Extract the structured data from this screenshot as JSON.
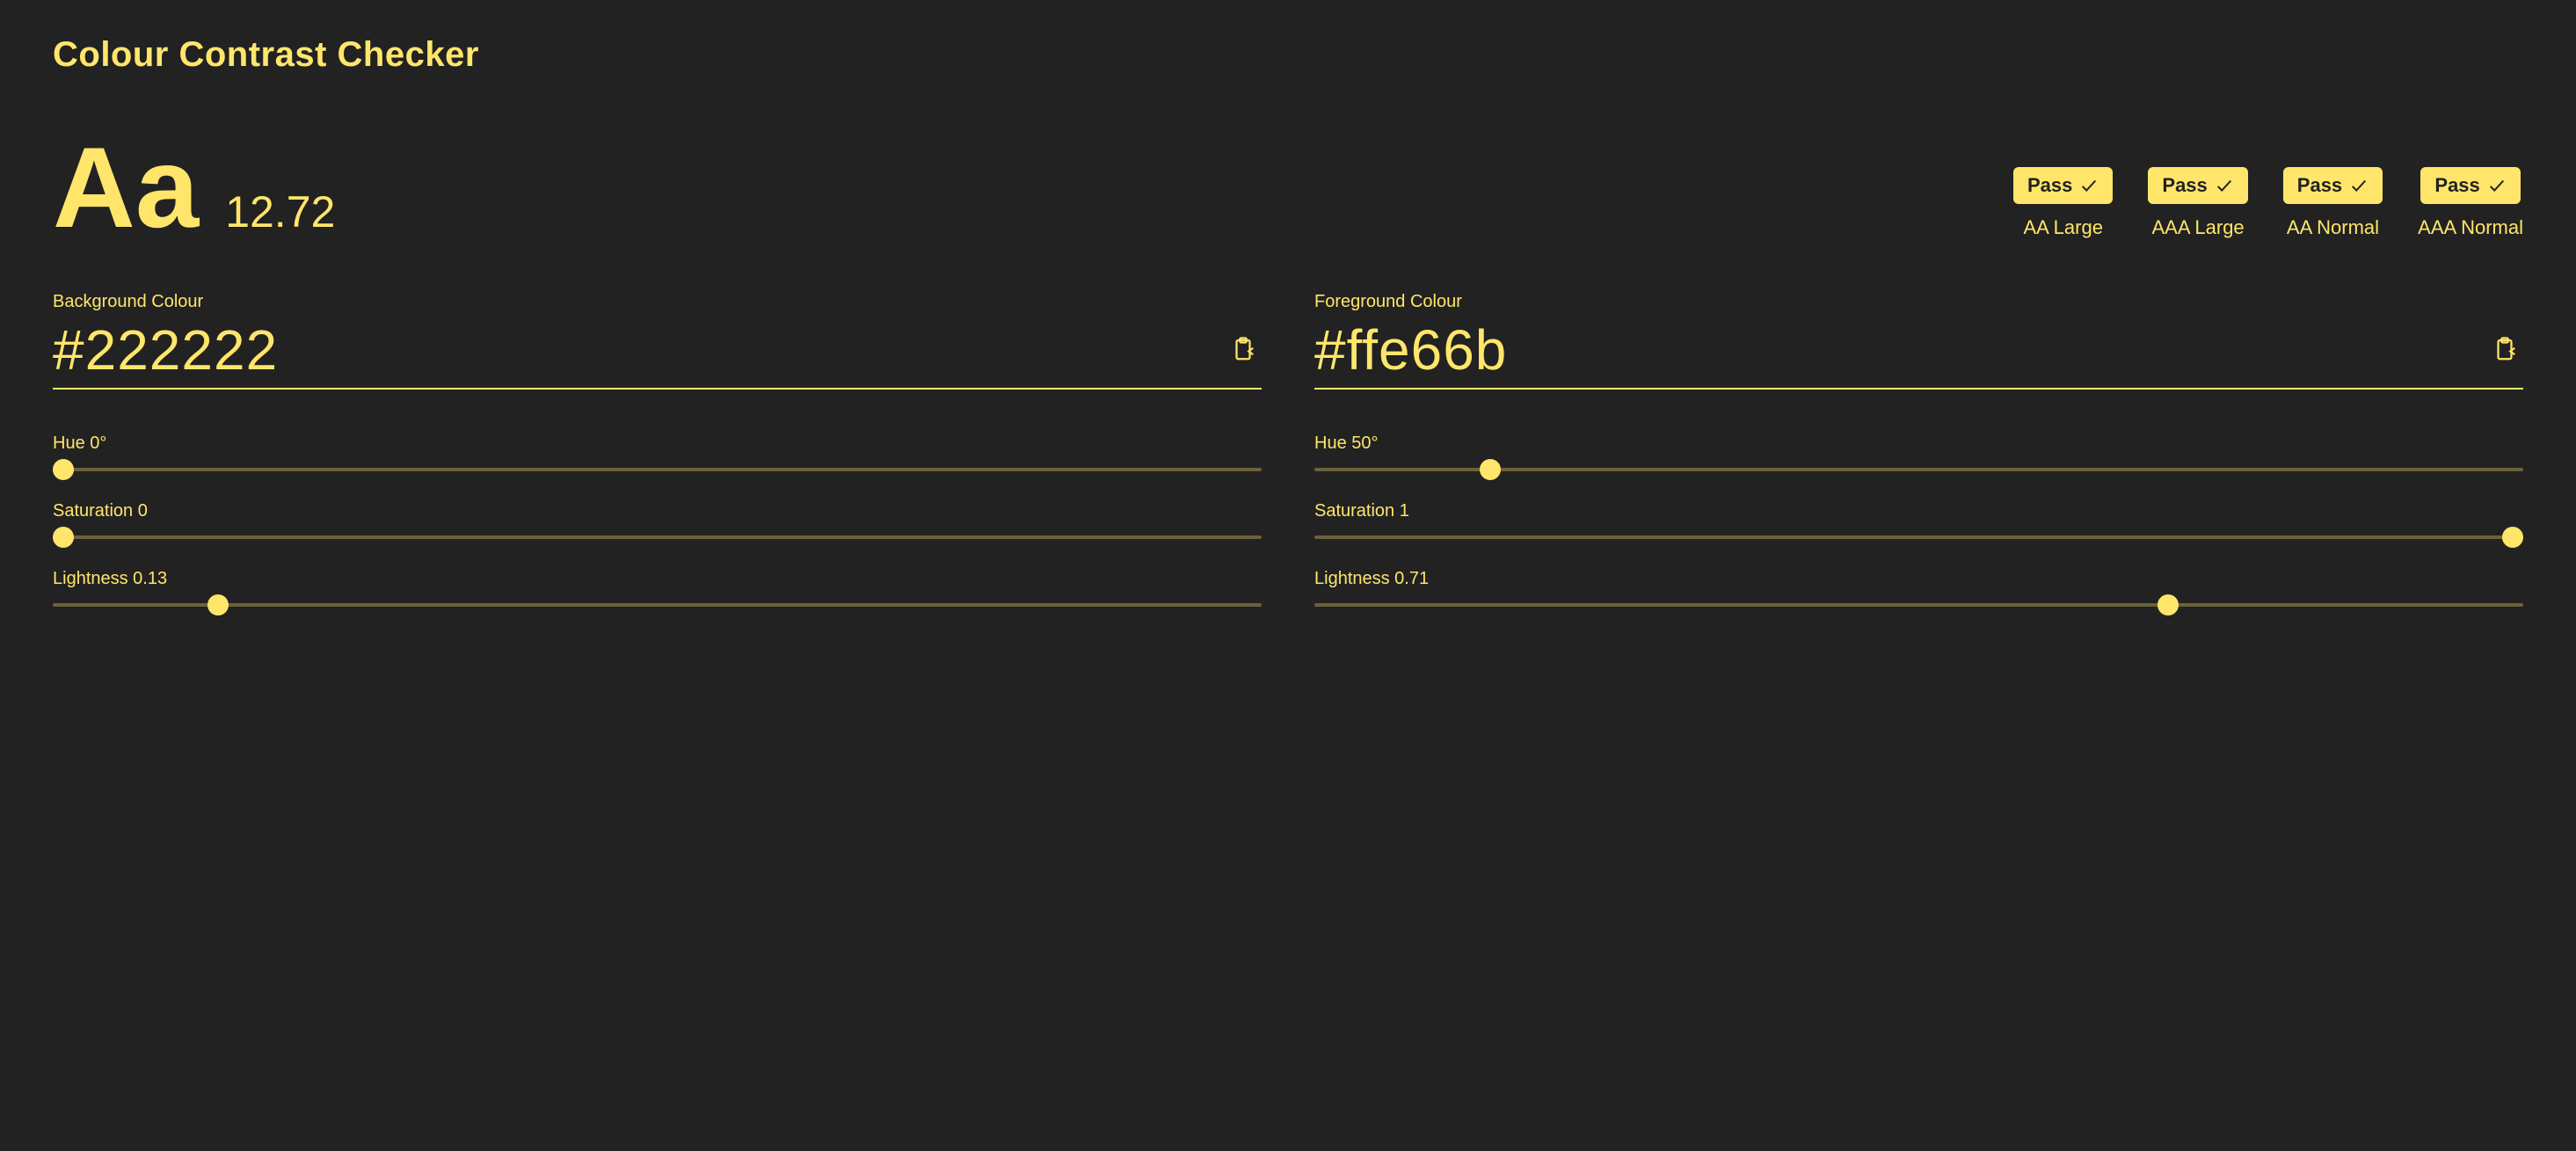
{
  "title": "Colour Contrast Checker",
  "sample": "Aa",
  "ratio": "12.72",
  "badges": [
    {
      "status": "Pass",
      "label": "AA Large"
    },
    {
      "status": "Pass",
      "label": "AAA Large"
    },
    {
      "status": "Pass",
      "label": "AA Normal"
    },
    {
      "status": "Pass",
      "label": "AAA Normal"
    }
  ],
  "background": {
    "label": "Background Colour",
    "hex": "#222222",
    "hue": {
      "label": "Hue 0°",
      "pct": 0
    },
    "saturation": {
      "label": "Saturation 0",
      "pct": 0
    },
    "lightness": {
      "label": "Lightness 0.13",
      "pct": 13
    }
  },
  "foreground": {
    "label": "Foreground Colour",
    "hex": "#ffe66b",
    "hue": {
      "label": "Hue 50°",
      "pct": 13.9
    },
    "saturation": {
      "label": "Saturation 1",
      "pct": 100
    },
    "lightness": {
      "label": "Lightness 0.71",
      "pct": 71
    }
  }
}
